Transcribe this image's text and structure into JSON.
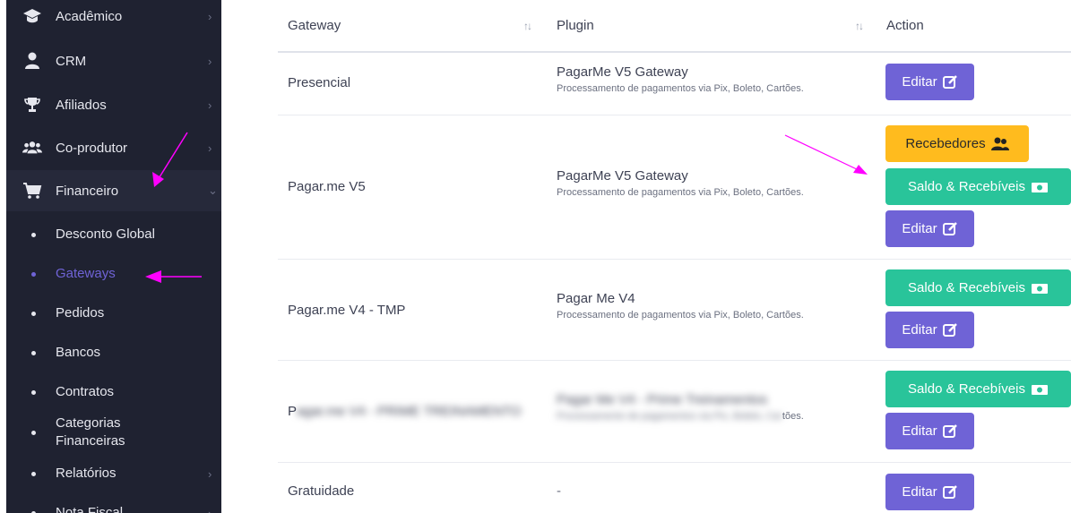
{
  "sidebar": {
    "items": [
      {
        "label": "Acadêmico",
        "icon": "graduation-cap-icon"
      },
      {
        "label": "CRM",
        "icon": "user-icon"
      },
      {
        "label": "Afiliados",
        "icon": "trophy-icon"
      },
      {
        "label": "Co-produtor",
        "icon": "users-icon"
      },
      {
        "label": "Financeiro",
        "icon": "cart-icon"
      }
    ],
    "chevron_right": "›",
    "chevron_down": "⌄",
    "subitems": [
      {
        "label": "Desconto Global"
      },
      {
        "label": "Gateways"
      },
      {
        "label": "Pedidos"
      },
      {
        "label": "Bancos"
      },
      {
        "label": "Contratos"
      },
      {
        "label": "Categorias Financeiras"
      },
      {
        "label": "Relatórios"
      },
      {
        "label": "Nota Fiscal"
      }
    ]
  },
  "table": {
    "headers": {
      "gateway": "Gateway",
      "plugin": "Plugin",
      "action": "Action",
      "sort": "↑↓"
    },
    "rows": [
      {
        "gateway": "Presencial",
        "plugin_name": "PagarMe V5 Gateway",
        "plugin_desc": "Processamento de pagamentos via Pix, Boleto, Cartões."
      },
      {
        "gateway": "Pagar.me V5",
        "plugin_name": "PagarMe V5 Gateway",
        "plugin_desc": "Processamento de pagamentos via Pix, Boleto, Cartões."
      },
      {
        "gateway": "Pagar.me V4 - TMP",
        "plugin_name": "Pagar Me V4",
        "plugin_desc": "Processamento de pagamentos via Pix, Boleto, Cartões."
      },
      {
        "gateway": "P",
        "gateway_blurred": "agar.me V4 - PRIME TREINAMENTO",
        "plugin_name": "Pagar Me V4 - Prime Treinamentos",
        "plugin_desc_blurred": "Processamento de pagamentos via Pix, Boleto, Car",
        "plugin_desc_tail": "tões."
      },
      {
        "gateway": "Gratuidade",
        "plugin_name": "-"
      }
    ]
  },
  "buttons": {
    "edit": "Editar",
    "saldo": "Saldo & Recebíveis",
    "recebedores": "Recebedores"
  },
  "colors": {
    "sidebar_bg": "#1f2231",
    "accent_purple": "#6f63d6",
    "green": "#29c49a",
    "yellow": "#ffbb1e",
    "annotation_arrow": "#ff00ff"
  }
}
